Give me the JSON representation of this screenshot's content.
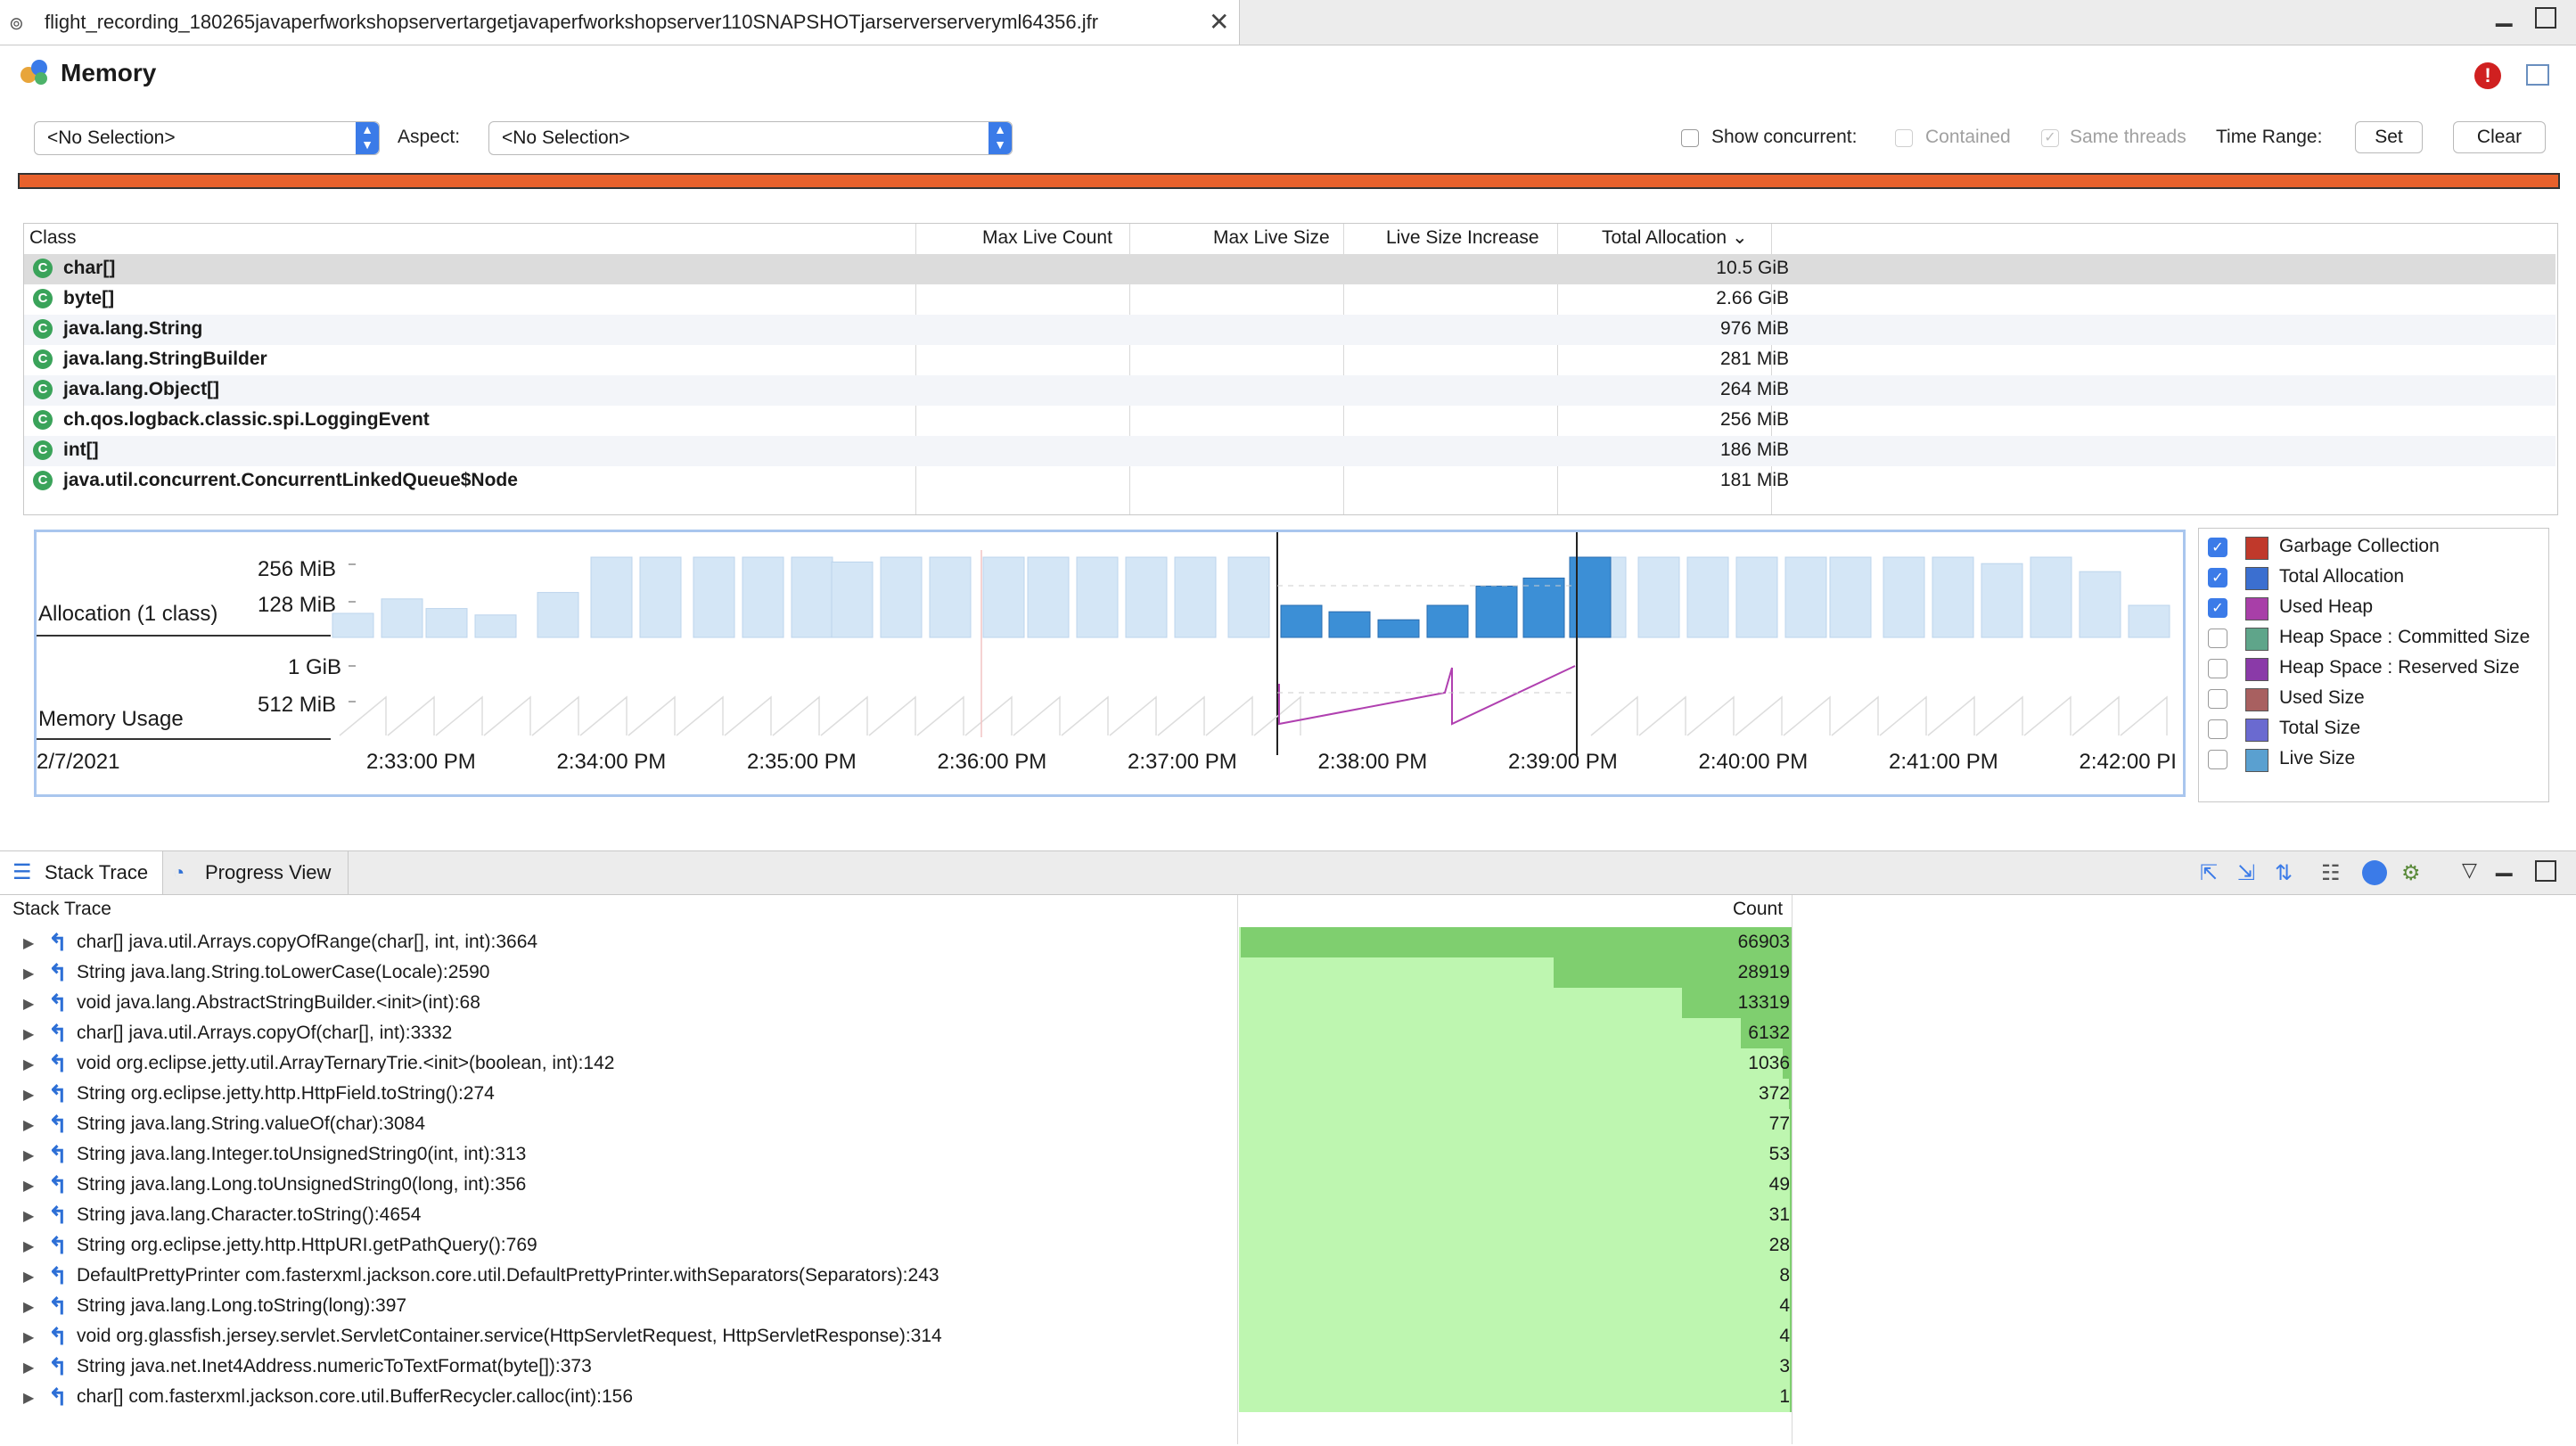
{
  "editor_tab": {
    "filename": "flight_recording_180265javaperfworkshopservertargetjavaperfworkshopserver110SNAPSHOTjarserverserveryml64356.jfr",
    "close": "✕"
  },
  "page": {
    "title": "Memory",
    "selection": "<No Selection>",
    "aspect_label": "Aspect:",
    "aspect_value": "<No Selection>",
    "show_concurrent": "Show concurrent:",
    "contained": "Contained",
    "same_threads": "Same threads",
    "time_range": "Time Range:",
    "set": "Set",
    "clear": "Clear",
    "error_icon": "!",
    "accent_color": "#e8612c"
  },
  "class_table": {
    "headers": [
      "Class",
      "Max Live Count",
      "Max Live Size",
      "Live Size Increase",
      "Total Allocation"
    ],
    "sort_indicator": "⌄",
    "rows": [
      {
        "name": "char[]",
        "alloc": "10.5 GiB"
      },
      {
        "name": "byte[]",
        "alloc": "2.66 GiB"
      },
      {
        "name": "java.lang.String",
        "alloc": "976 MiB"
      },
      {
        "name": "java.lang.StringBuilder",
        "alloc": "281 MiB"
      },
      {
        "name": "java.lang.Object[]",
        "alloc": "264 MiB"
      },
      {
        "name": "ch.qos.logback.classic.spi.LoggingEvent",
        "alloc": "256 MiB"
      },
      {
        "name": "int[]",
        "alloc": "186 MiB"
      },
      {
        "name": "java.util.concurrent.ConcurrentLinkedQueue$Node",
        "alloc": "181 MiB"
      }
    ]
  },
  "chart": {
    "allocation_label": "Allocation (1 class)",
    "memory_label": "Memory Usage",
    "date_label": "2/7/2021",
    "alloc_ticks": [
      "256 MiB",
      "128 MiB"
    ],
    "memory_ticks": [
      "1 GiB",
      "512 MiB"
    ],
    "time_ticks": [
      "2:33:00 PM",
      "2:34:00 PM",
      "2:35:00 PM",
      "2:36:00 PM",
      "2:37:00 PM",
      "2:38:00 PM",
      "2:39:00 PM",
      "2:40:00 PM",
      "2:41:00 PM",
      "2:42:00 PI"
    ]
  },
  "legend": [
    {
      "label": "Garbage Collection",
      "checked": true,
      "color": "#c0392b"
    },
    {
      "label": "Total Allocation",
      "checked": true,
      "color": "#3b6fd0"
    },
    {
      "label": "Used Heap",
      "checked": true,
      "color": "#a83fa8"
    },
    {
      "label": "Heap Space : Committed Size",
      "checked": false,
      "color": "#5fa58a"
    },
    {
      "label": "Heap Space : Reserved Size",
      "checked": false,
      "color": "#8a3aa8"
    },
    {
      "label": "Used Size",
      "checked": false,
      "color": "#a86060"
    },
    {
      "label": "Total Size",
      "checked": false,
      "color": "#6a6ad0"
    },
    {
      "label": "Live Size",
      "checked": false,
      "color": "#5aa0d0"
    }
  ],
  "bottom": {
    "tab_stack": "Stack Trace",
    "tab_progress": "Progress View",
    "col_trace": "Stack Trace",
    "col_count": "Count",
    "rows": [
      {
        "frame": "char[] java.util.Arrays.copyOfRange(char[], int, int):3664",
        "count": "66903"
      },
      {
        "frame": "String java.lang.String.toLowerCase(Locale):2590",
        "count": "28919"
      },
      {
        "frame": "void java.lang.AbstractStringBuilder.<init>(int):68",
        "count": "13319"
      },
      {
        "frame": "char[] java.util.Arrays.copyOf(char[], int):3332",
        "count": "6132"
      },
      {
        "frame": "void org.eclipse.jetty.util.ArrayTernaryTrie.<init>(boolean, int):142",
        "count": "1036"
      },
      {
        "frame": "String org.eclipse.jetty.http.HttpField.toString():274",
        "count": "372"
      },
      {
        "frame": "String java.lang.String.valueOf(char):3084",
        "count": "77"
      },
      {
        "frame": "String java.lang.Integer.toUnsignedString0(int, int):313",
        "count": "53"
      },
      {
        "frame": "String java.lang.Long.toUnsignedString0(long, int):356",
        "count": "49"
      },
      {
        "frame": "String java.lang.Character.toString():4654",
        "count": "31"
      },
      {
        "frame": "String org.eclipse.jetty.http.HttpURI.getPathQuery():769",
        "count": "28"
      },
      {
        "frame": "DefaultPrettyPrinter com.fasterxml.jackson.core.util.DefaultPrettyPrinter.withSeparators(Separators):243",
        "count": "8"
      },
      {
        "frame": "String java.lang.Long.toString(long):397",
        "count": "4"
      },
      {
        "frame": "void org.glassfish.jersey.servlet.ServletContainer.service(HttpServletRequest, HttpServletResponse):314",
        "count": "4"
      },
      {
        "frame": "String java.net.Inet4Address.numericToTextFormat(byte[]):373",
        "count": "3"
      },
      {
        "frame": "char[] com.fasterxml.jackson.core.util.BufferRecycler.calloc(int):156",
        "count": "1"
      }
    ]
  }
}
